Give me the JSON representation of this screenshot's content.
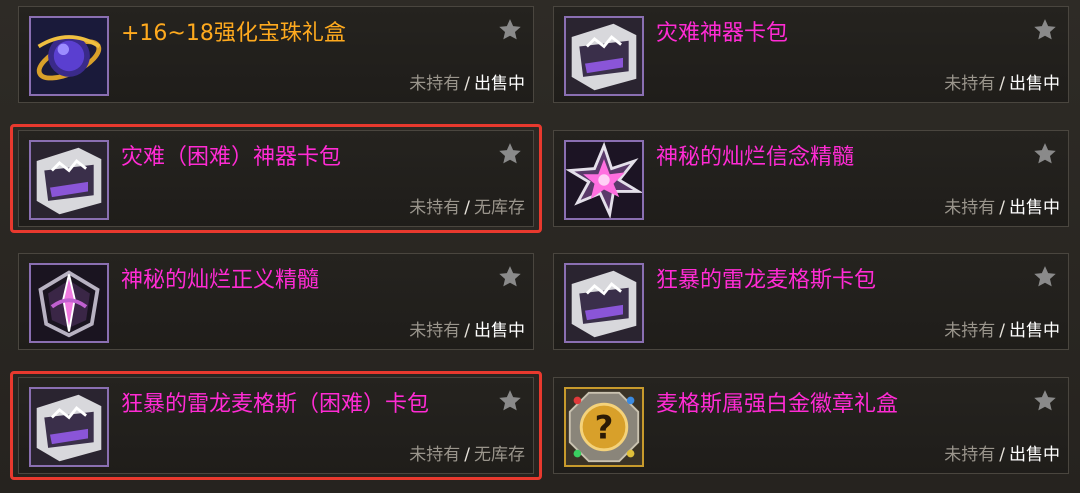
{
  "items": [
    {
      "name": "+16~18强化宝珠礼盒",
      "name_color": "orange",
      "icon": "orb-icon",
      "owned": "未持有",
      "sep": "/",
      "sale": "出售中",
      "highlight": false
    },
    {
      "name": "灾难神器卡包",
      "name_color": "magenta",
      "icon": "card-pack-icon",
      "owned": "未持有",
      "sep": "/",
      "sale": "出售中",
      "highlight": false
    },
    {
      "name": "灾难（困难）神器卡包",
      "name_color": "magenta",
      "icon": "card-pack-icon",
      "owned": "未持有",
      "sep": "/",
      "sale": "无库存",
      "highlight": true
    },
    {
      "name": "神秘的灿烂信念精髓",
      "name_color": "magenta",
      "icon": "crystal-burst-icon",
      "owned": "未持有",
      "sep": "/",
      "sale": "出售中",
      "highlight": false
    },
    {
      "name": "神秘的灿烂正义精髓",
      "name_color": "magenta",
      "icon": "emblem-icon",
      "owned": "未持有",
      "sep": "/",
      "sale": "出售中",
      "highlight": false
    },
    {
      "name": "狂暴的雷龙麦格斯卡包",
      "name_color": "magenta",
      "icon": "card-pack-icon",
      "owned": "未持有",
      "sep": "/",
      "sale": "出售中",
      "highlight": false
    },
    {
      "name": "狂暴的雷龙麦格斯（困难）卡包",
      "name_color": "magenta",
      "icon": "card-pack-icon",
      "owned": "未持有",
      "sep": "/",
      "sale": "无库存",
      "highlight": true
    },
    {
      "name": "麦格斯属强白金徽章礼盒",
      "name_color": "magenta",
      "icon": "mystery-box-icon",
      "owned": "未持有",
      "sep": "/",
      "sale": "出售中",
      "highlight": false
    }
  ],
  "colors": {
    "magenta": "#ff2bd4",
    "orange": "#ffaa1e",
    "highlight": "#e8392e"
  }
}
